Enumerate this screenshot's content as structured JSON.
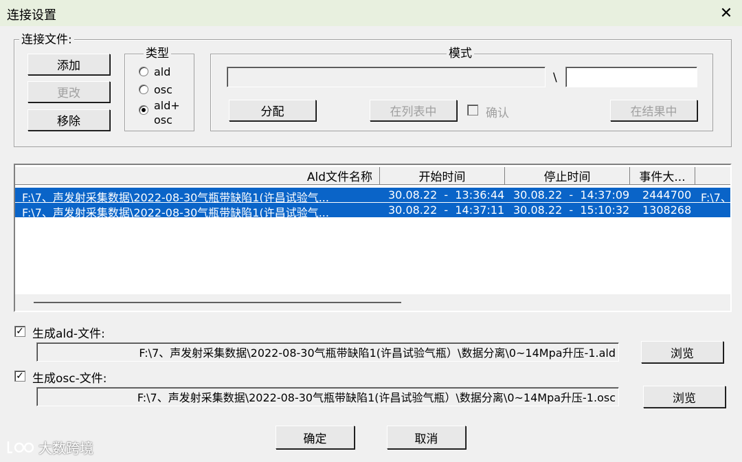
{
  "window": {
    "title": "连接设置",
    "close_glyph": "✕"
  },
  "connect_files": {
    "legend": "连接文件:",
    "add_label": "添加",
    "change_label": "更改",
    "remove_label": "移除"
  },
  "type_group": {
    "legend": "类型",
    "options": [
      {
        "label": "ald",
        "checked": false
      },
      {
        "label": "osc",
        "checked": false
      },
      {
        "label": "ald+\nosc",
        "checked": true
      }
    ]
  },
  "mode_group": {
    "legend": "模式",
    "left_value": "",
    "separator": "\\",
    "right_value": "",
    "assign_label": "分配",
    "in_list_label": "在列表中",
    "confirm_label": "确认",
    "confirm_checked": false,
    "in_result_label": "在结果中"
  },
  "file_list": {
    "columns": [
      "Ald文件名称",
      "开始时间",
      "停止时间",
      "事件大..."
    ],
    "rows": [
      {
        "name": "F:\\7、声发射采集数据\\2022-08-30气瓶带缺陷1(许昌试验气...",
        "start": "30.08.22  -  13:36:44",
        "stop": "30.08.22  -  14:37:09",
        "events": "2444700",
        "extra": "F:\\7、"
      },
      {
        "name": "F:\\7、声发射采集数据\\2022-08-30气瓶带缺陷1(许昌试验气...",
        "start": "30.08.22  -  14:37:11",
        "stop": "30.08.22  -  15:10:32",
        "events": "1308268",
        "extra": ""
      }
    ]
  },
  "ald_output": {
    "checkbox_label": "生成ald-文件:",
    "checked": true,
    "path": "F:\\7、声发射采集数据\\2022-08-30气瓶带缺陷1(许昌试验气瓶）\\数据分离\\0~14Mpa升压-1.ald",
    "browse_label": "浏览"
  },
  "osc_output": {
    "checkbox_label": "生成osc-文件:",
    "checked": true,
    "path": "F:\\7、声发射采集数据\\2022-08-30气瓶带缺陷1(许昌试验气瓶）\\数据分离\\0~14Mpa升压-1.osc",
    "browse_label": "浏览"
  },
  "footer": {
    "ok_label": "确定",
    "cancel_label": "取消"
  },
  "watermark": {
    "text": "大数跨境"
  }
}
